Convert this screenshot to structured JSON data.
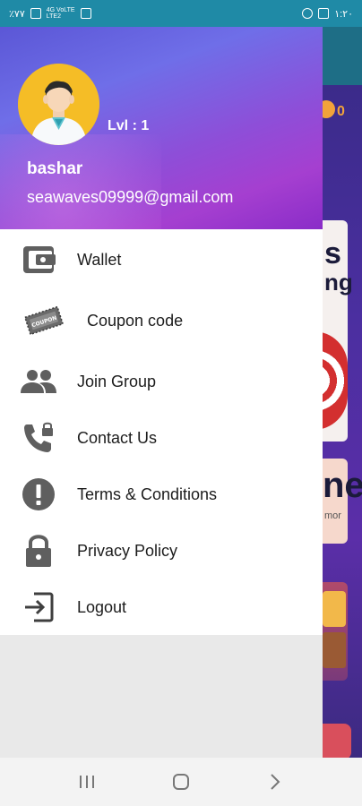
{
  "status_bar": {
    "left_text": "٪٧٧",
    "network_top": "4G VoLTE",
    "network_bottom": "LTE2",
    "time": "١:٢٠"
  },
  "background_app": {
    "coin_value": "0",
    "card1_line1": "s",
    "card1_line2": "ng",
    "card2_line1": "ne",
    "card2_line2": "mor"
  },
  "profile": {
    "level_label": "Lvl :  1",
    "username": "bashar",
    "email": "seawaves09999@gmail.com"
  },
  "menu": {
    "items": [
      {
        "label": "Wallet",
        "icon": "wallet-icon"
      },
      {
        "label": "Coupon code",
        "icon": "coupon-icon"
      },
      {
        "label": "Join Group",
        "icon": "group-icon"
      },
      {
        "label": "Contact Us",
        "icon": "phone-lock-icon"
      },
      {
        "label": "Terms & Conditions",
        "icon": "info-icon"
      },
      {
        "label": "Privacy Policy",
        "icon": "lock-icon"
      },
      {
        "label": "Logout",
        "icon": "logout-icon"
      }
    ]
  },
  "coupon_badge_text": "COUPON",
  "colors": {
    "status_bar": "#1f8aa6",
    "header_start": "#5b57d6",
    "header_end": "#a53fd0",
    "avatar_bg": "#f5bd26",
    "icon_gray": "#5f5f5f"
  }
}
